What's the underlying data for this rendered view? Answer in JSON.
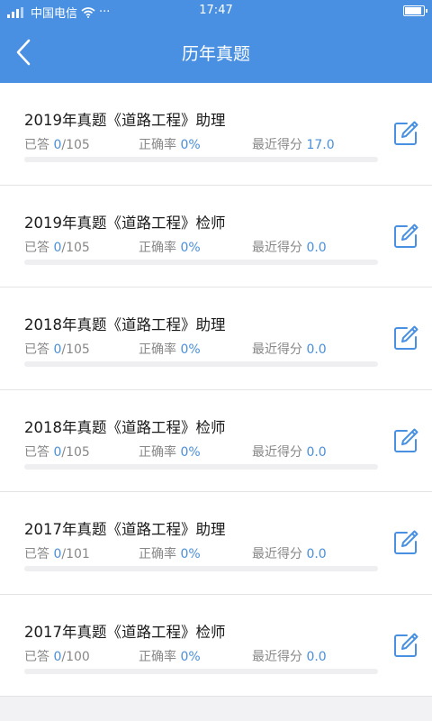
{
  "status_bar": {
    "carrier": "中国电信",
    "time": "17:47"
  },
  "header": {
    "title": "历年真题"
  },
  "labels": {
    "answered": "已答",
    "accuracy": "正确率",
    "recent_score": "最近得分"
  },
  "exams": [
    {
      "title": "2019年真题《道路工程》助理",
      "answered": "0",
      "total": "105",
      "accuracy": "0%",
      "score": "17.0",
      "progress": 0
    },
    {
      "title": "2019年真题《道路工程》检师",
      "answered": "0",
      "total": "105",
      "accuracy": "0%",
      "score": "0.0",
      "progress": 0
    },
    {
      "title": "2018年真题《道路工程》助理",
      "answered": "0",
      "total": "105",
      "accuracy": "0%",
      "score": "0.0",
      "progress": 0
    },
    {
      "title": "2018年真题《道路工程》检师",
      "answered": "0",
      "total": "105",
      "accuracy": "0%",
      "score": "0.0",
      "progress": 0
    },
    {
      "title": "2017年真题《道路工程》助理",
      "answered": "0",
      "total": "101",
      "accuracy": "0%",
      "score": "0.0",
      "progress": 0
    },
    {
      "title": "2017年真题《道路工程》检师",
      "answered": "0",
      "total": "100",
      "accuracy": "0%",
      "score": "0.0",
      "progress": 0
    }
  ],
  "colors": {
    "brand": "#4a90e2",
    "value": "#4a8fd9"
  },
  "icons": {
    "back": "chevron-left-icon",
    "edit": "edit-icon"
  }
}
